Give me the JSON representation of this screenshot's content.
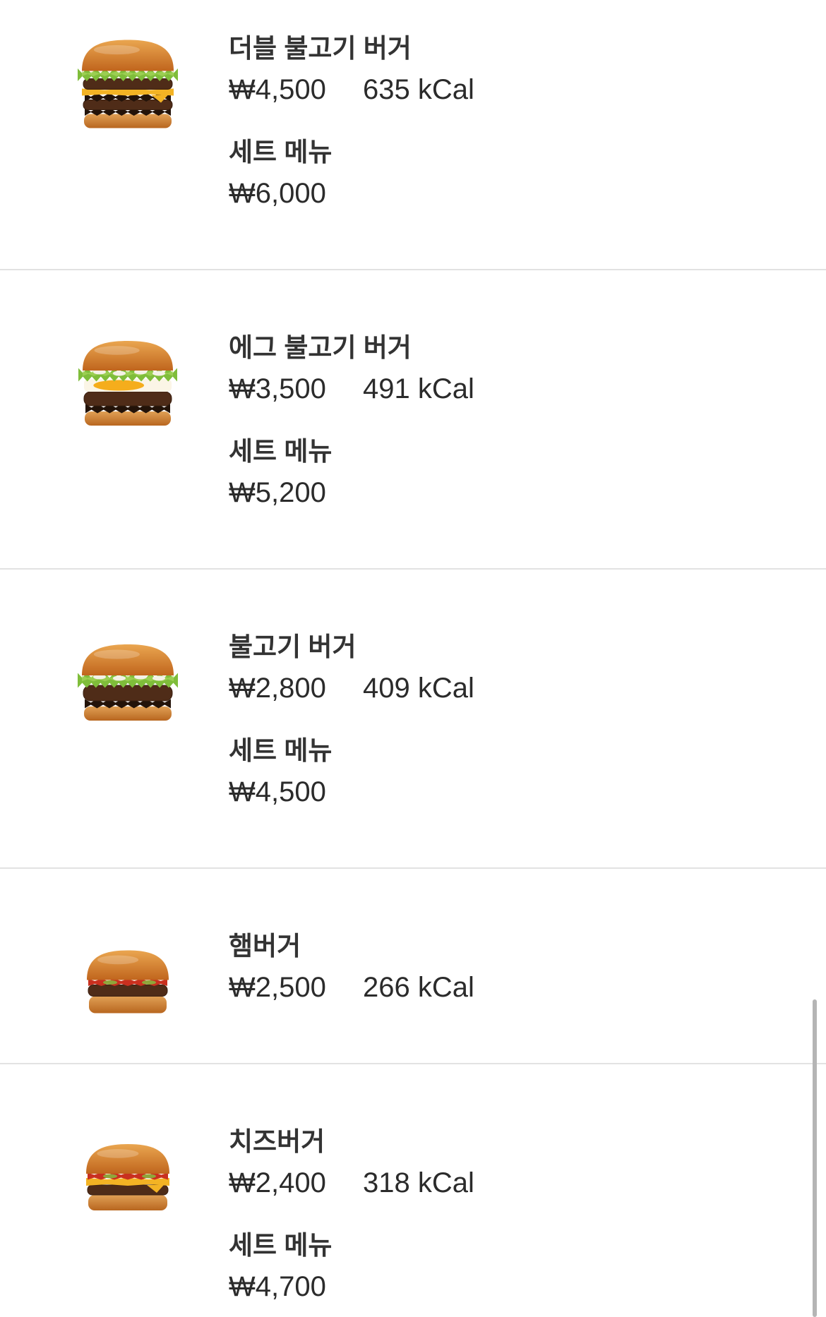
{
  "menu_items": [
    {
      "name": "더블 불고기 버거",
      "price": "₩4,500",
      "calories": "635 kCal",
      "set_label": "세트 메뉴",
      "set_price": "₩6,000",
      "icon": "double-bulgogi-burger-icon"
    },
    {
      "name": "에그 불고기 버거",
      "price": "₩3,500",
      "calories": "491 kCal",
      "set_label": "세트 메뉴",
      "set_price": "₩5,200",
      "icon": "egg-bulgogi-burger-icon"
    },
    {
      "name": "불고기 버거",
      "price": "₩2,800",
      "calories": "409 kCal",
      "set_label": "세트 메뉴",
      "set_price": "₩4,500",
      "icon": "bulgogi-burger-icon"
    },
    {
      "name": "햄버거",
      "price": "₩2,500",
      "calories": "266 kCal",
      "icon": "hamburger-icon"
    },
    {
      "name": "치즈버거",
      "price": "₩2,400",
      "calories": "318 kCal",
      "set_label": "세트 메뉴",
      "set_price": "₩4,700",
      "icon": "cheeseburger-icon"
    }
  ],
  "colors": {
    "background": "#ffffff",
    "text": "#2b2b2b",
    "divider": "#e2e2e2",
    "scrollbar": "#b5b5b5"
  }
}
